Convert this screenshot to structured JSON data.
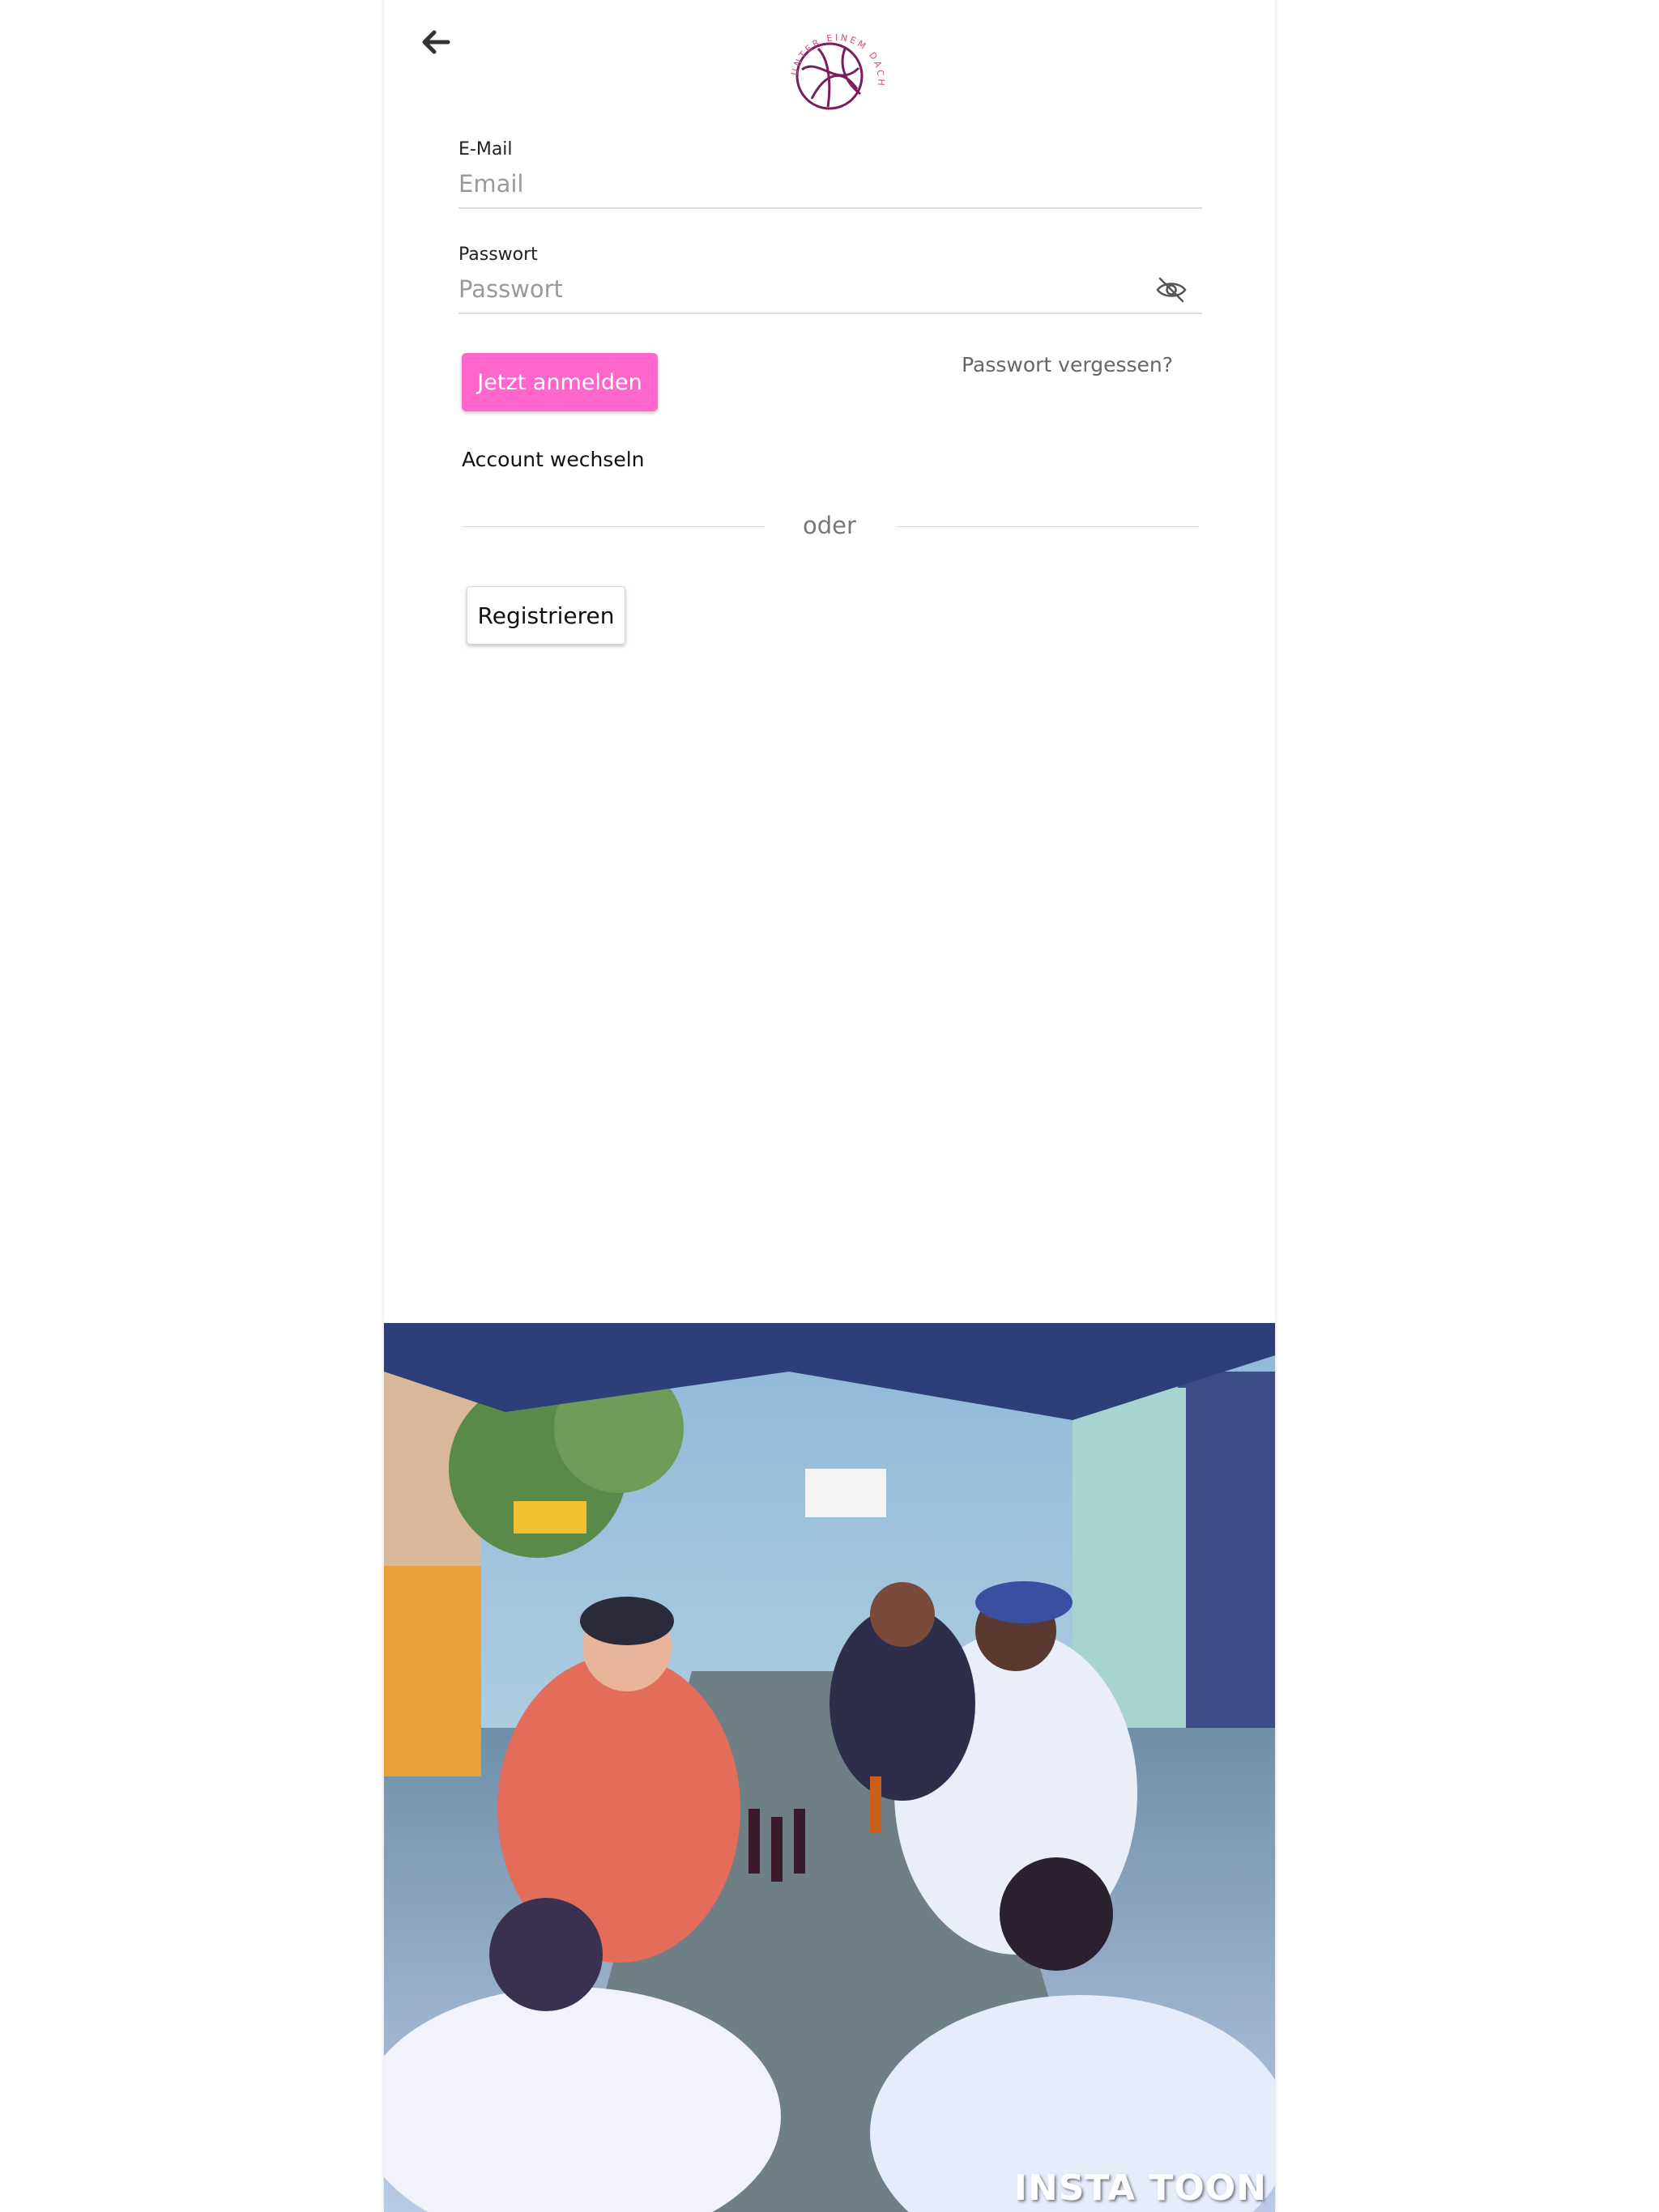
{
  "brand": {
    "logo_text": "UNTER EINEM DACH",
    "accent_color": "#ff66cc",
    "logo_color": "#7a1f5c"
  },
  "header": {
    "back_icon": "arrow-left-icon"
  },
  "form": {
    "email": {
      "label": "E-Mail",
      "placeholder": "Email",
      "value": ""
    },
    "password": {
      "label": "Passwort",
      "placeholder": "Passwort",
      "value": "",
      "toggle_icon": "eye-slash-icon"
    },
    "login_label": "Jetzt anmelden",
    "forgot_label": "Passwort vergessen?",
    "switch_account_label": "Account wechseln",
    "divider_label": "oder",
    "register_label": "Registrieren"
  },
  "photo": {
    "watermark": "INSTA TOON"
  }
}
